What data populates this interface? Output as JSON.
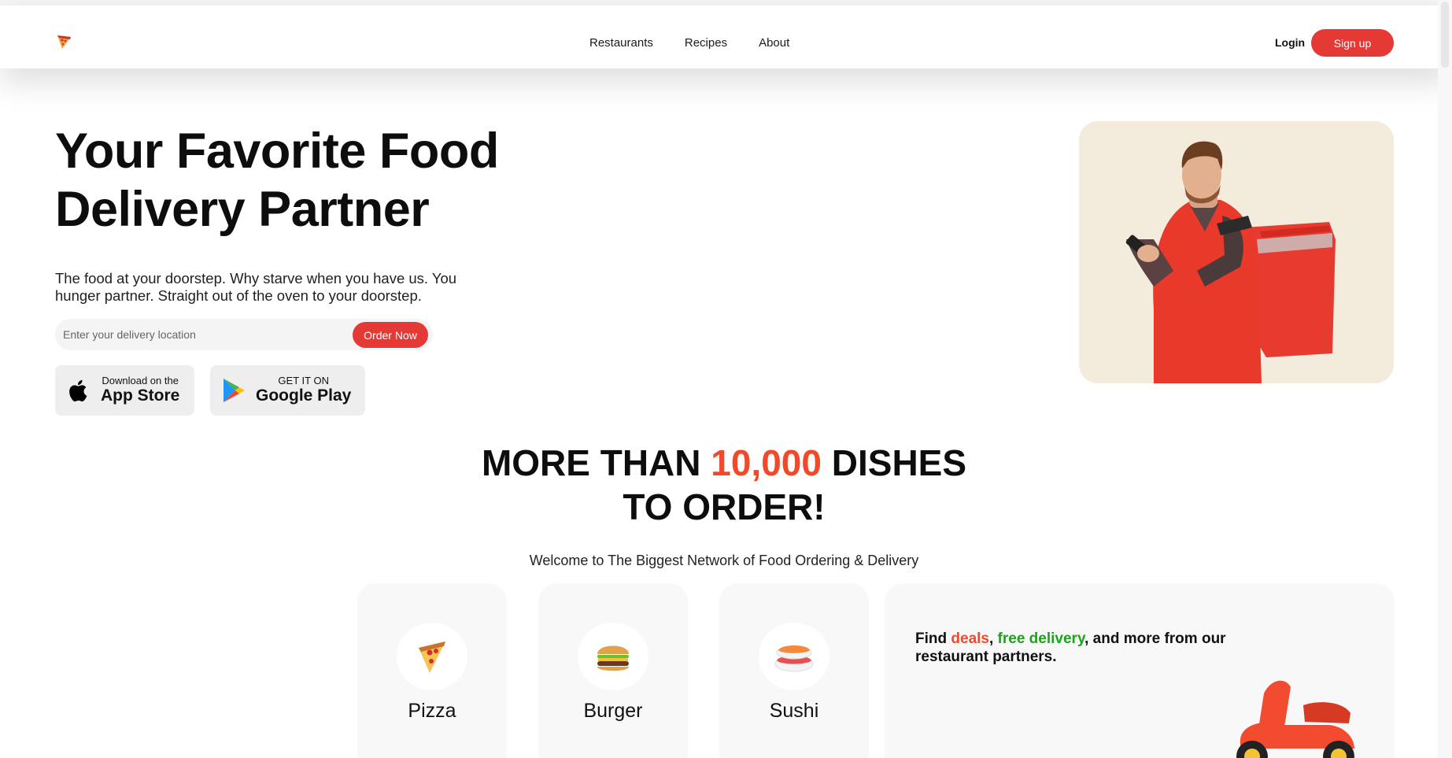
{
  "nav": {
    "links": [
      "Restaurants",
      "Recipes",
      "About"
    ],
    "login": "Login",
    "signup": "Sign up"
  },
  "hero": {
    "title_line1": "Your Favorite Food",
    "title_line2": "Delivery Partner",
    "description": "The food at your doorstep. Why starve when you have us. You hunger partner. Straight out of the oven to your doorstep.",
    "search_placeholder": "Enter your delivery location",
    "order_button": "Order Now"
  },
  "stores": {
    "appstore_small": "Download on the",
    "appstore_big": "App Store",
    "google_small": "GET IT ON",
    "google_big": "Google Play"
  },
  "headline": {
    "part1": "MORE THAN ",
    "accent": "10,000",
    "part2": " DISHES",
    "line2": "TO ORDER!"
  },
  "subline": "Welcome to The Biggest Network of Food Ordering & Delivery",
  "categories": [
    {
      "label": "Pizza",
      "icon": "pizza-icon"
    },
    {
      "label": "Burger",
      "icon": "burger-icon"
    },
    {
      "label": "Sushi",
      "icon": "sushi-icon"
    }
  ],
  "deals": {
    "find": "Find ",
    "deals": "deals",
    "comma": ", ",
    "free_delivery": "free delivery",
    "rest": ", and more from our restaurant partners."
  },
  "colors": {
    "accent_red": "#e53935",
    "headline_orange": "#f04a2a",
    "deal_green": "#1aa51a",
    "hero_bg": "#f3ebdc"
  }
}
